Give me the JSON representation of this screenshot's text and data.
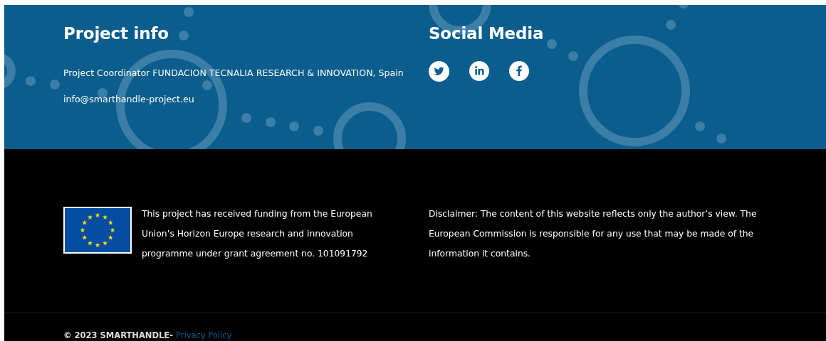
{
  "project_info": {
    "title": "Project info",
    "coordinator": "Project Coordinator FUNDACION TECNALIA RESEARCH & INNOVATION, Spain",
    "email": "info@smarthandle-project.eu"
  },
  "social_media": {
    "title": "Social Media",
    "links": [
      {
        "kind": "twitter"
      },
      {
        "kind": "linkedin"
      },
      {
        "kind": "facebook"
      }
    ]
  },
  "funding": {
    "text": "This project has received funding from the European Union’s Horizon Europe research and innovation programme under grant agreement no. 101091792"
  },
  "disclaimer": "Disclaimer: The content of this website reflects only the author’s view. The European Commission is responsible for any use that may be made of the information it contains.",
  "copyright": {
    "text": "© 2023 SMARTHANDLE-",
    "privacy_link": "Privacy Policy"
  }
}
